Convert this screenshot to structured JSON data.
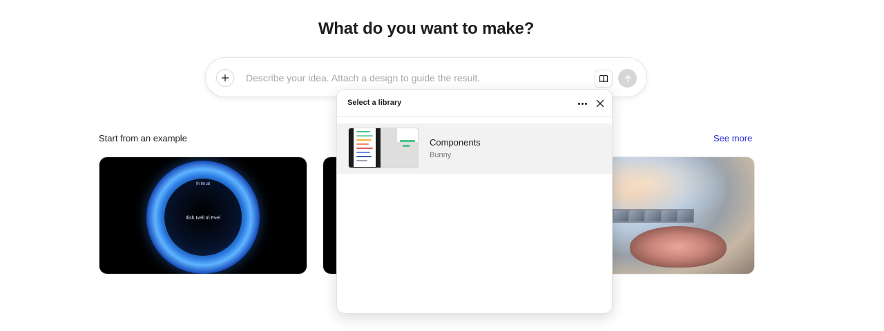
{
  "page": {
    "heading": "What do you want to make?"
  },
  "prompt": {
    "placeholder": "Describe your idea. Attach a design to guide the result.",
    "value": "",
    "add_icon": "plus-icon",
    "library_icon": "book-open-icon",
    "send_icon": "arrow-up-icon"
  },
  "examples": {
    "label": "Start from an example",
    "see_more": "See more",
    "cards": [
      {
        "name": "portal-example",
        "text_top": "Ih tm.at",
        "text_center": "Ilish Ivell tri Fvel"
      },
      {
        "name": "dark-example"
      },
      {
        "name": "portrait-example"
      }
    ]
  },
  "library_popover": {
    "title": "Select a library",
    "more_icon": "more-horizontal-icon",
    "close_icon": "close-icon",
    "items": [
      {
        "name": "Components",
        "owner": "Bunny"
      }
    ]
  },
  "colors": {
    "link": "#2a2ae0",
    "send_disabled": "#d6d6d6",
    "selected_row": "#f2f2f2"
  }
}
